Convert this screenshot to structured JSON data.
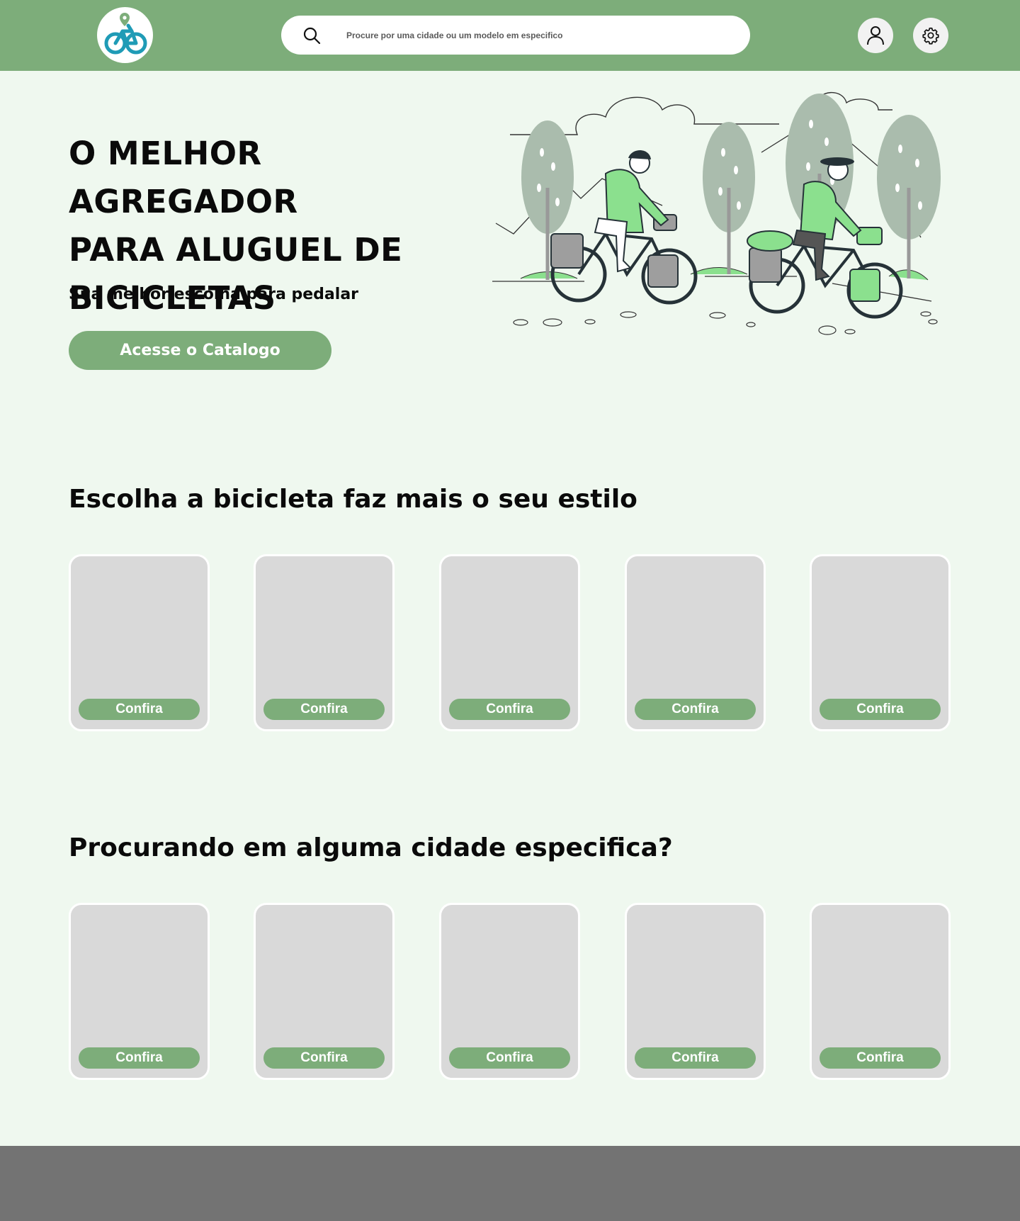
{
  "header": {
    "logo_icon": "bike-location-logo-icon",
    "search": {
      "placeholder": "Procure por uma cidade ou um modelo em especifico",
      "value": "",
      "icon": "search-icon"
    },
    "user_icon": "user-icon",
    "settings_icon": "gear-icon"
  },
  "hero": {
    "title_lines": [
      "O MELHOR AGREGADOR",
      "PARA ALUGUEL DE",
      "BICICLETAS"
    ],
    "subtitle": "Sua melhor escolha para pedalar",
    "cta_label": "Acesse o Catalogo",
    "illustration": "cyclists-illustration"
  },
  "styles_section": {
    "title": "Escolha a bicicleta faz mais o seu estilo",
    "cards": [
      {
        "button": "Confira"
      },
      {
        "button": "Confira"
      },
      {
        "button": "Confira"
      },
      {
        "button": "Confira"
      },
      {
        "button": "Confira"
      }
    ]
  },
  "cities_section": {
    "title": "Procurando em alguma cidade especifica?",
    "cards": [
      {
        "button": "Confira"
      },
      {
        "button": "Confira"
      },
      {
        "button": "Confira"
      },
      {
        "button": "Confira"
      },
      {
        "button": "Confira"
      }
    ]
  },
  "colors": {
    "brand_green": "#7dad7a",
    "page_background": "#eff8ef",
    "card_placeholder": "#d9d9d9",
    "footer": "#737373",
    "illustration_accent": "#8be08e"
  }
}
